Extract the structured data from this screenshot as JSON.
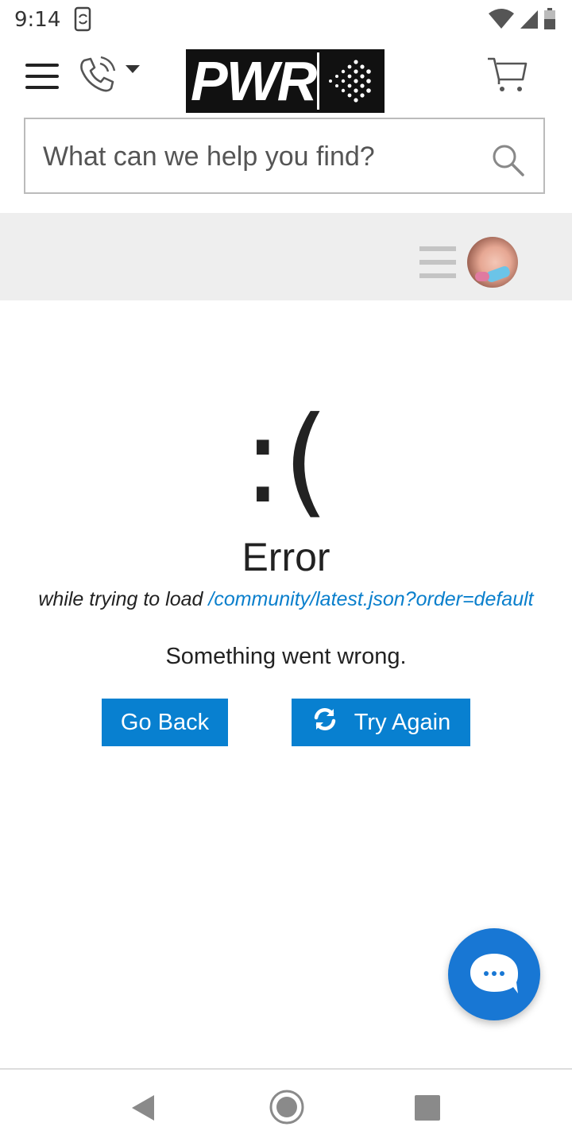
{
  "status_bar": {
    "time": "9:14",
    "icons": [
      "sync-phone-icon",
      "wifi-icon",
      "signal-icon",
      "battery-icon"
    ]
  },
  "header": {
    "logo_text": "PWR",
    "icons": [
      "hamburger-icon",
      "phone-icon",
      "caret-down-icon",
      "cart-icon"
    ]
  },
  "search": {
    "placeholder": "What can we help you find?"
  },
  "error": {
    "face": ":(",
    "title": "Error",
    "load_prefix": "while trying to load",
    "url": "/community/latest.json?order=default",
    "description": "Something went wrong.",
    "go_back_label": "Go Back",
    "try_again_label": "Try Again"
  },
  "colors": {
    "accent": "#0880d0",
    "link": "#0a7fcc",
    "fab": "#1877d4",
    "graybar": "#eeeeee"
  }
}
